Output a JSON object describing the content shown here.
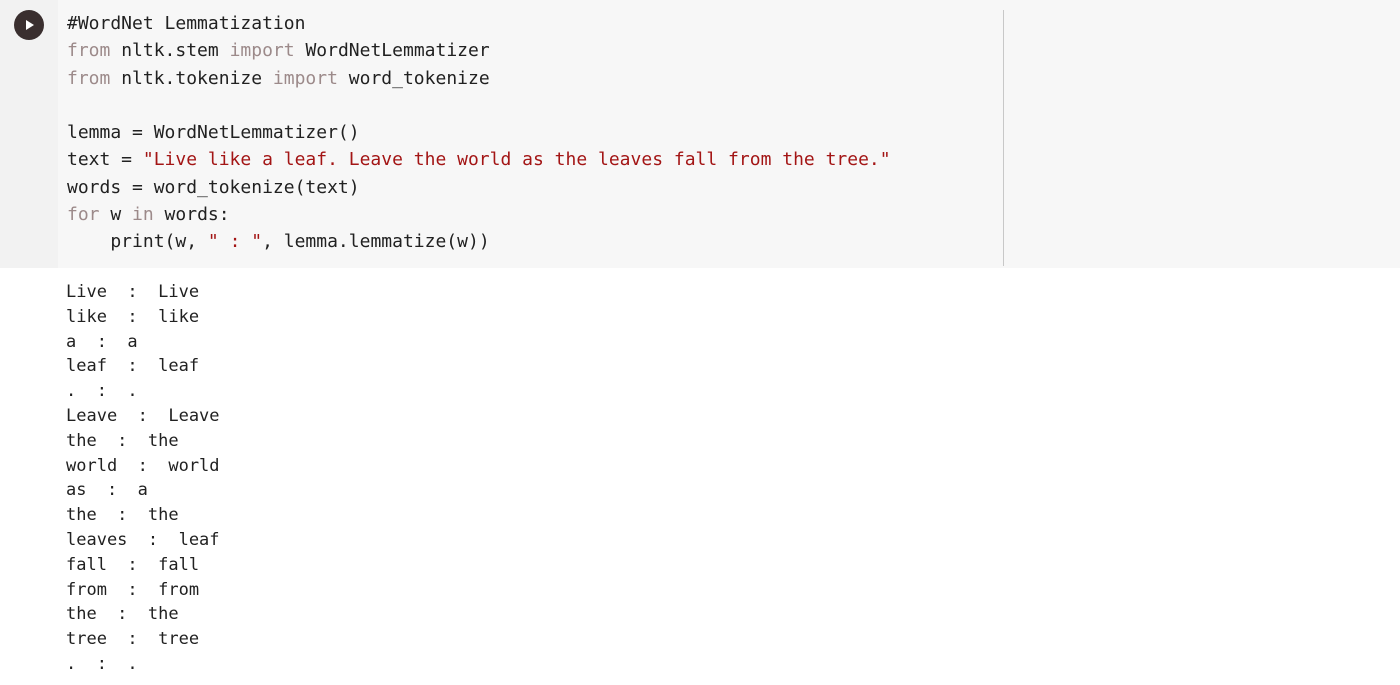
{
  "code_cell": {
    "run_button_label": "Run cell",
    "lines": [
      {
        "parts": [
          {
            "t": "#WordNet Lemmatization",
            "c": "plain"
          }
        ]
      },
      {
        "parts": [
          {
            "t": "from",
            "c": "kw"
          },
          {
            "t": " nltk.stem ",
            "c": "plain"
          },
          {
            "t": "import",
            "c": "kw"
          },
          {
            "t": " WordNetLemmatizer",
            "c": "plain"
          }
        ]
      },
      {
        "parts": [
          {
            "t": "from",
            "c": "kw"
          },
          {
            "t": " nltk.tokenize ",
            "c": "plain"
          },
          {
            "t": "import",
            "c": "kw"
          },
          {
            "t": " word_tokenize",
            "c": "plain"
          }
        ]
      },
      {
        "parts": [
          {
            "t": "",
            "c": "plain"
          }
        ]
      },
      {
        "parts": [
          {
            "t": "lemma = WordNetLemmatizer()",
            "c": "plain"
          }
        ]
      },
      {
        "parts": [
          {
            "t": "text = ",
            "c": "plain"
          },
          {
            "t": "\"Live like a leaf. Leave the world as the leaves fall from the tree.\"",
            "c": "str"
          }
        ]
      },
      {
        "parts": [
          {
            "t": "words = word_tokenize(text)",
            "c": "plain"
          }
        ]
      },
      {
        "parts": [
          {
            "t": "for",
            "c": "kw"
          },
          {
            "t": " w ",
            "c": "plain"
          },
          {
            "t": "in",
            "c": "kw"
          },
          {
            "t": " words:",
            "c": "plain"
          }
        ]
      },
      {
        "parts": [
          {
            "t": "    print(w, ",
            "c": "plain"
          },
          {
            "t": "\" : \"",
            "c": "str"
          },
          {
            "t": ", lemma.lemmatize(w))",
            "c": "plain"
          }
        ]
      }
    ]
  },
  "output": {
    "lines": [
      "Live  :  Live",
      "like  :  like",
      "a  :  a",
      "leaf  :  leaf",
      ".  :  .",
      "Leave  :  Leave",
      "the  :  the",
      "world  :  world",
      "as  :  a",
      "the  :  the",
      "leaves  :  leaf",
      "fall  :  fall",
      "from  :  from",
      "the  :  the",
      "tree  :  tree",
      ".  :  ."
    ]
  }
}
